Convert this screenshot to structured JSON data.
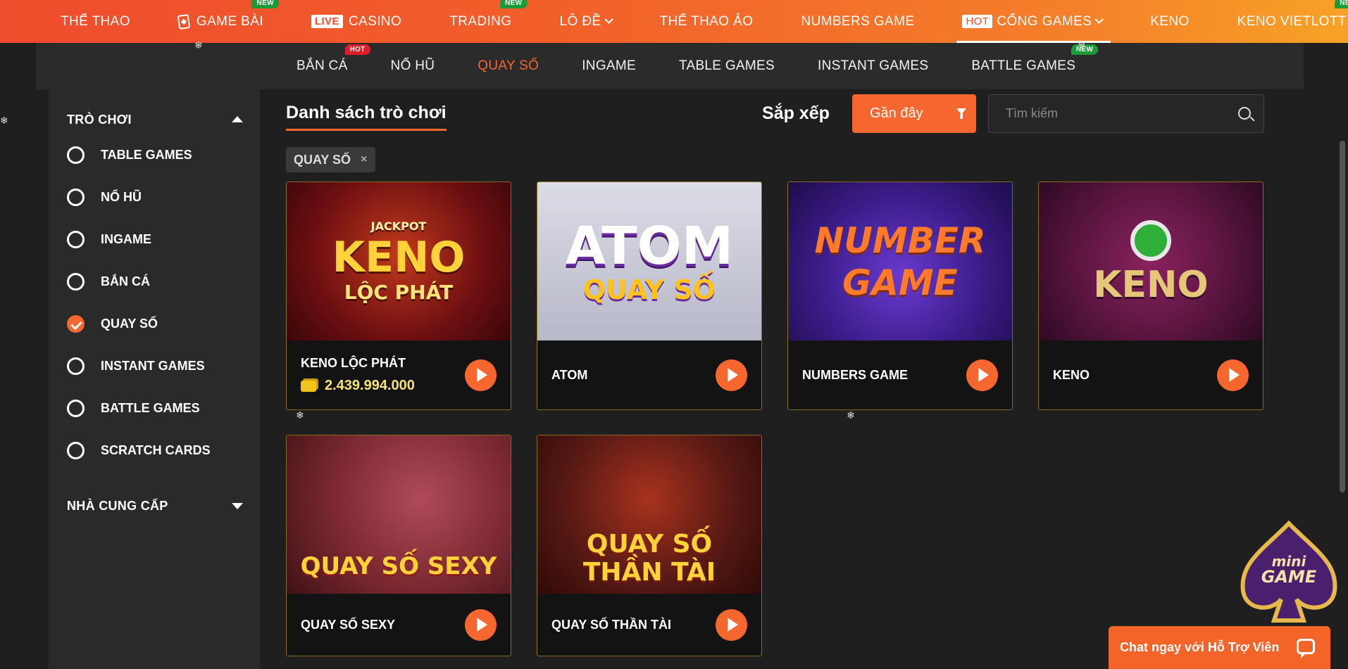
{
  "topnav": {
    "items": [
      {
        "label": "THỂ THAO",
        "tag": "",
        "prefix": ""
      },
      {
        "label": "GAME BÀI",
        "tag": "NEW",
        "prefix": "card"
      },
      {
        "label": "CASINO",
        "tag": "",
        "prefix": "LIVE"
      },
      {
        "label": "TRADING",
        "tag": "NEW",
        "prefix": ""
      },
      {
        "label": "LÔ ĐỀ",
        "tag": "",
        "prefix": ""
      },
      {
        "label": "THỂ THAO ẢO",
        "tag": "",
        "prefix": ""
      },
      {
        "label": "NUMBERS GAME",
        "tag": "",
        "prefix": ""
      },
      {
        "label": "CỔNG GAMES",
        "tag": "",
        "prefix": "HOT"
      },
      {
        "label": "KENO",
        "tag": "",
        "prefix": ""
      },
      {
        "label": "KENO VIETLOTT",
        "tag": "NEW",
        "prefix": ""
      }
    ]
  },
  "subnav": {
    "items": [
      {
        "label": "BẮN CÁ",
        "tag": "HOT"
      },
      {
        "label": "NỔ HŨ",
        "tag": ""
      },
      {
        "label": "QUAY SỐ",
        "tag": ""
      },
      {
        "label": "INGAME",
        "tag": ""
      },
      {
        "label": "TABLE GAMES",
        "tag": ""
      },
      {
        "label": "INSTANT GAMES",
        "tag": ""
      },
      {
        "label": "BATTLE GAMES",
        "tag": "NEW"
      }
    ]
  },
  "sidebar": {
    "games_heading": "TRÒ CHƠI",
    "filters": [
      {
        "label": "TABLE GAMES",
        "checked": false
      },
      {
        "label": "NỔ HŨ",
        "checked": false
      },
      {
        "label": "INGAME",
        "checked": false
      },
      {
        "label": "BẮN CÁ",
        "checked": false
      },
      {
        "label": "QUAY SỐ",
        "checked": true
      },
      {
        "label": "INSTANT GAMES",
        "checked": false
      },
      {
        "label": "BATTLE GAMES",
        "checked": false
      },
      {
        "label": "SCRATCH CARDS",
        "checked": false
      }
    ],
    "provider_heading": "NHÀ CUNG CẤP"
  },
  "main": {
    "list_title": "Danh sách trò chơi",
    "sort_label": "Sắp xếp",
    "sort_value": "Gần đây",
    "search_placeholder": "Tìm kiếm",
    "active_chip": "QUAY SỐ",
    "chip_close": "×"
  },
  "games": [
    {
      "name": "KENO LỘC PHÁT",
      "jackpot": "2.439.994.000",
      "art_lines": [
        "JACKPOT",
        "KENO",
        "LỘC PHÁT"
      ],
      "bg": "#6e0f12"
    },
    {
      "name": "ATOM",
      "jackpot": "",
      "art_lines": [
        "ATOM",
        "QUAY SỐ"
      ],
      "bg": "#c9c9d6"
    },
    {
      "name": "NUMBERS GAME",
      "jackpot": "",
      "art_lines": [
        "NUMBER",
        "GAME"
      ],
      "bg": "#3b1d8a"
    },
    {
      "name": "KENO",
      "jackpot": "",
      "art_lines": [
        "KENO"
      ],
      "bg": "#5a1540"
    },
    {
      "name": "QUAY SỐ SEXY",
      "jackpot": "",
      "art_lines": [
        "QUAY SỐ SEXY"
      ],
      "bg": "#7a2830"
    },
    {
      "name": "QUAY SỐ THẦN TÀI",
      "jackpot": "",
      "art_lines": [
        "QUAY SỐ",
        "THẦN TÀI"
      ],
      "bg": "#5a1a14"
    }
  ],
  "widgets": {
    "minigame_line1": "mini",
    "minigame_line2": "GAME",
    "chat_label": "Chat ngay với Hỗ Trợ Viên"
  },
  "colors": {
    "accent": "#f5672e",
    "topbar_start": "#ef4b2c",
    "topbar_end": "#f7a226",
    "tag_new": "#1c9a3a",
    "tag_hot": "#e01c2a",
    "jackpot": "#f6e27a"
  }
}
